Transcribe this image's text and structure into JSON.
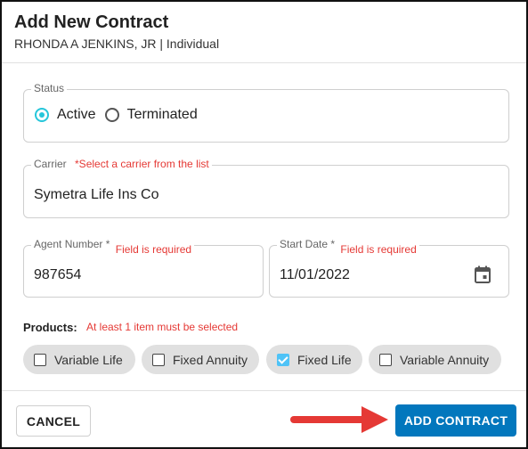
{
  "dialog": {
    "title": "Add New Contract",
    "subtitle": "RHONDA A JENKINS, JR | Individual"
  },
  "status": {
    "label": "Status",
    "options": [
      {
        "label": "Active",
        "selected": true
      },
      {
        "label": "Terminated",
        "selected": false
      }
    ]
  },
  "carrier": {
    "label": "Carrier",
    "error": "*Select a carrier from the list",
    "value": "Symetra Life Ins Co"
  },
  "agent_number": {
    "label": "Agent Number *",
    "error": "Field is required",
    "value": "987654"
  },
  "start_date": {
    "label": "Start Date *",
    "error": "Field is required",
    "value": "11/01/2022",
    "icon": "calendar-icon"
  },
  "products": {
    "label": "Products:",
    "error": "At least 1 item must be selected",
    "items": [
      {
        "label": "Variable Life",
        "checked": false
      },
      {
        "label": "Fixed Annuity",
        "checked": false
      },
      {
        "label": "Fixed Life",
        "checked": true
      },
      {
        "label": "Variable Annuity",
        "checked": false
      }
    ]
  },
  "actions": {
    "cancel_label": "CANCEL",
    "add_label": "ADD CONTRACT"
  },
  "colors": {
    "primary": "#0277bd",
    "error": "#e53935",
    "radio_accent": "#26c6da",
    "checkbox_accent": "#4fc3f7",
    "arrow": "#e53935"
  }
}
